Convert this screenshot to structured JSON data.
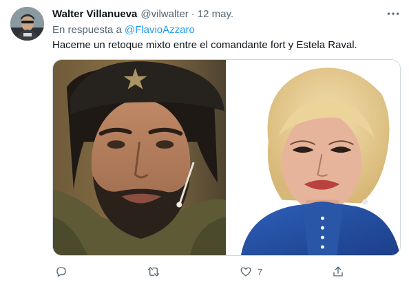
{
  "tweet": {
    "author_name": "Walter Villanueva",
    "handle": "@vilwalter",
    "separator": "·",
    "date": "12 may.",
    "reply_prefix": "En respuesta a",
    "reply_mention": "@FlavioAzzaro",
    "text": "Haceme un retoque mixto entre el comandante fort y Estela Raval."
  },
  "icons": {
    "more": "more-dots-icon",
    "reply": "reply-icon",
    "retweet": "retweet-icon",
    "like": "heart-icon",
    "share": "share-icon"
  },
  "actions": {
    "reply_count": "",
    "retweet_count": "",
    "like_count": "7"
  },
  "colors": {
    "link": "#1d9bf0",
    "secondary_text": "#536471",
    "primary_text": "#0f1419",
    "border": "#cfd9de"
  }
}
